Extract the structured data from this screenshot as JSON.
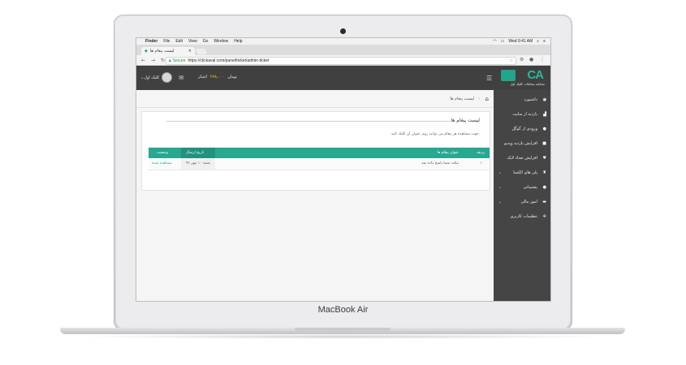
{
  "device": {
    "brand_label": "MacBook Air"
  },
  "menubar": {
    "items": [
      "Finder",
      "File",
      "Edit",
      "View",
      "Go",
      "Window",
      "Help"
    ],
    "clock": "Wed 9:41 AM"
  },
  "browser": {
    "tab_title": "لیست پیغام ها",
    "security_label": "Secure",
    "url": "https://clickaval.com/panel/ticket/admin-ticket"
  },
  "header": {
    "logo_text": "CA",
    "logo_subtitle": "سامانه معاملات کلیک اول",
    "user_name": "کلیک اول",
    "credit_label": "اعتبار",
    "credit_amount": "۲۷۸,۰۰۰",
    "credit_unit": "تومان"
  },
  "sidebar": {
    "items": [
      {
        "label": "داشبورد",
        "icon": "dashboard-icon",
        "has_arrow": false
      },
      {
        "label": "بازدید از سایت",
        "icon": "chart-icon",
        "has_arrow": false
      },
      {
        "label": "ورودی از گوگل",
        "icon": "google-icon",
        "has_arrow": false
      },
      {
        "label": "افزایش بازدید ویدیو",
        "icon": "video-icon",
        "has_arrow": false
      },
      {
        "label": "افزایش تعداد لایک",
        "icon": "heart-icon",
        "has_arrow": false
      },
      {
        "label": "پلن های الکسا",
        "icon": "alexa-icon",
        "has_arrow": true
      },
      {
        "label": "پشتیبانی",
        "icon": "chat-icon",
        "has_arrow": true
      },
      {
        "label": "امور مالی",
        "icon": "finance-icon",
        "has_arrow": true
      },
      {
        "label": "تنظیمات کاربری",
        "icon": "settings-icon",
        "has_arrow": false
      }
    ]
  },
  "content": {
    "breadcrumb": "لیست پیغام ها",
    "panel_title": "لیست پیغام ها",
    "hint": "جهت مشاهده هر پیغام می توانید روی عنوان آن کلیک کنید.",
    "table": {
      "headers": {
        "row": "ردیف",
        "title": "عنوان پیغام ها",
        "date": "تاریخ ارسال",
        "status": "وضعیت"
      },
      "rows": [
        {
          "row": "۱",
          "title": "تیکت شما پاسخ داده شد",
          "date": "شنبه ۱۰ مهر ۹۶",
          "status": "مشاهده شده"
        }
      ]
    }
  },
  "colors": {
    "accent": "#28a791",
    "sidebar_bg": "#454545",
    "header_bg": "#404040",
    "credit": "#f3c433"
  }
}
